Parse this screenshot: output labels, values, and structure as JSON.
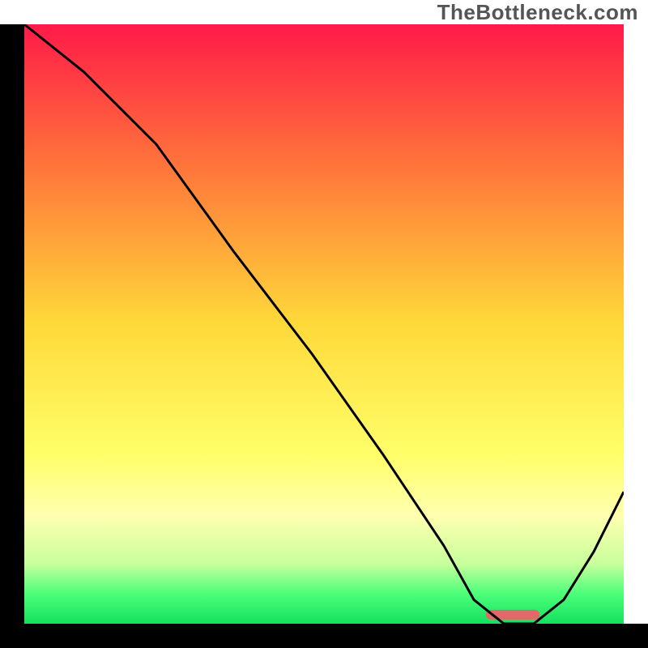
{
  "watermark": "TheBottleneck.com",
  "chart_data": {
    "type": "line",
    "title": "",
    "xlabel": "",
    "ylabel": "",
    "xlim": [
      0,
      100
    ],
    "ylim": [
      0,
      100
    ],
    "background_gradient": {
      "stops": [
        {
          "offset": 0.0,
          "color": "#ff1a48"
        },
        {
          "offset": 0.25,
          "color": "#ff7a3a"
        },
        {
          "offset": 0.5,
          "color": "#ffd93a"
        },
        {
          "offset": 0.72,
          "color": "#ffff6a"
        },
        {
          "offset": 0.82,
          "color": "#ffffb0"
        },
        {
          "offset": 0.9,
          "color": "#c8ff9c"
        },
        {
          "offset": 0.95,
          "color": "#4cff7a"
        },
        {
          "offset": 1.0,
          "color": "#15e060"
        }
      ]
    },
    "series": [
      {
        "name": "bottleneck-curve",
        "color": "#000000",
        "x": [
          0,
          10,
          22,
          35,
          48,
          60,
          70,
          75,
          80,
          85,
          90,
          95,
          100
        ],
        "y": [
          100,
          92,
          80,
          62,
          45,
          28,
          13,
          4,
          0,
          0,
          4,
          12,
          22
        ]
      }
    ],
    "optimal_marker": {
      "x_start": 77,
      "x_end": 86,
      "y": 1.5,
      "color": "#e06a6a",
      "thickness": 12
    },
    "axes_color": "#000000",
    "axes_width": 28
  }
}
